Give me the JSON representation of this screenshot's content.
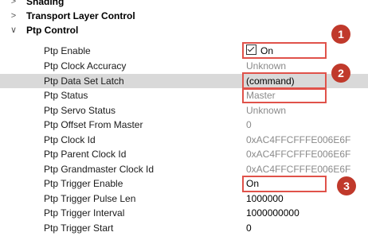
{
  "groups": [
    {
      "label": "Shading",
      "expanded": false
    },
    {
      "label": "Transport Layer Control",
      "expanded": false
    },
    {
      "label": "Ptp Control",
      "expanded": true
    }
  ],
  "chevrons": {
    "collapsed": ">",
    "expanded": "∨"
  },
  "properties": [
    {
      "name": "Ptp Enable",
      "value": "On",
      "checkbox": true,
      "gray": false
    },
    {
      "name": "Ptp Clock Accuracy",
      "value": "Unknown",
      "gray": true
    },
    {
      "name": "Ptp Data Set Latch",
      "value": "(command)",
      "gray": false,
      "selected": true
    },
    {
      "name": "Ptp Status",
      "value": "Master",
      "gray": true
    },
    {
      "name": "Ptp Servo Status",
      "value": "Unknown",
      "gray": true
    },
    {
      "name": "Ptp Offset From Master",
      "value": "0",
      "gray": true
    },
    {
      "name": "Ptp Clock Id",
      "value": "0xAC4FFCFFFE006E6F",
      "gray": true
    },
    {
      "name": "Ptp Parent Clock Id",
      "value": "0xAC4FFCFFFE006E6F",
      "gray": true
    },
    {
      "name": "Ptp Grandmaster Clock Id",
      "value": "0xAC4FFCFFFE006E6F",
      "gray": true
    },
    {
      "name": "Ptp Trigger Enable",
      "value": "On",
      "gray": false
    },
    {
      "name": "Ptp Trigger Pulse Len",
      "value": "1000000",
      "gray": false
    },
    {
      "name": "Ptp Trigger Interval",
      "value": "1000000000",
      "gray": false
    },
    {
      "name": "Ptp Trigger Start",
      "value": "0",
      "gray": false
    }
  ],
  "annotations": [
    "1",
    "2",
    "3"
  ],
  "colors": {
    "highlight": "#e0524a",
    "badge": "#c0392b",
    "selected_row": "#d9d9d9"
  }
}
